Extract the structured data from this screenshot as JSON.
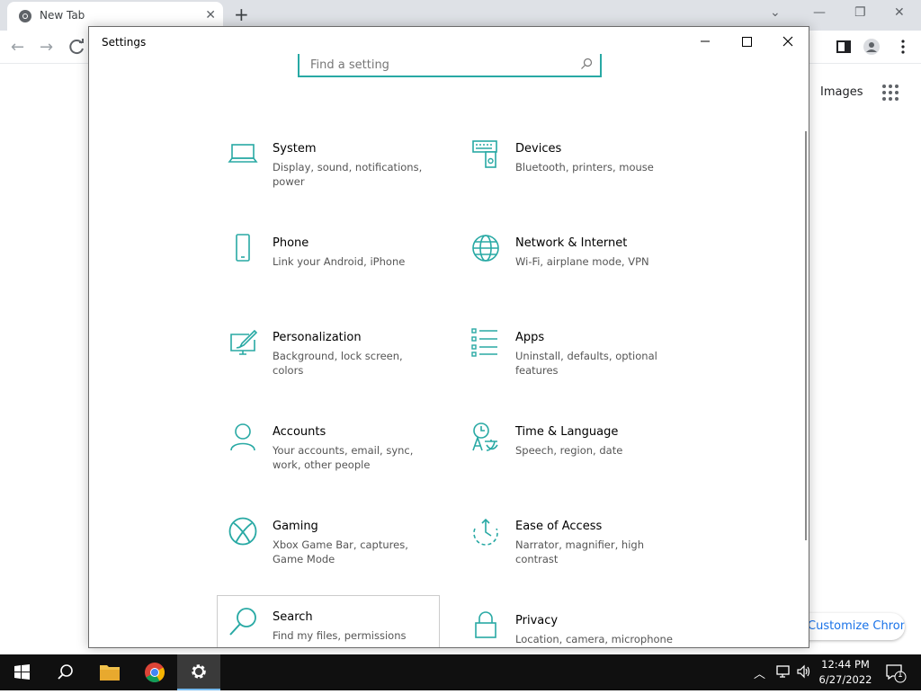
{
  "browser": {
    "tab_title": "New Tab",
    "images_link": "Images",
    "customize_label": "Customize Chrome"
  },
  "settings": {
    "title": "Settings",
    "search_placeholder": "Find a setting",
    "accent_color": "#28a9a4",
    "tiles": [
      {
        "name": "System",
        "desc": "Display, sound, notifications, power",
        "icon": "laptop-icon"
      },
      {
        "name": "Devices",
        "desc": "Bluetooth, printers, mouse",
        "icon": "devices-icon"
      },
      {
        "name": "Phone",
        "desc": "Link your Android, iPhone",
        "icon": "phone-icon"
      },
      {
        "name": "Network & Internet",
        "desc": "Wi-Fi, airplane mode, VPN",
        "icon": "globe-icon"
      },
      {
        "name": "Personalization",
        "desc": "Background, lock screen, colors",
        "icon": "paintbrush-icon"
      },
      {
        "name": "Apps",
        "desc": "Uninstall, defaults, optional features",
        "icon": "apps-list-icon"
      },
      {
        "name": "Accounts",
        "desc": "Your accounts, email, sync, work, other people",
        "icon": "person-icon"
      },
      {
        "name": "Time & Language",
        "desc": "Speech, region, date",
        "icon": "time-language-icon"
      },
      {
        "name": "Gaming",
        "desc": "Xbox Game Bar, captures, Game Mode",
        "icon": "xbox-icon"
      },
      {
        "name": "Ease of Access",
        "desc": "Narrator, magnifier, high contrast",
        "icon": "ease-of-access-icon"
      },
      {
        "name": "Search",
        "desc": "Find my files, permissions",
        "icon": "magnifier-icon"
      },
      {
        "name": "Privacy",
        "desc": "Location, camera, microphone",
        "icon": "lock-icon"
      }
    ]
  },
  "taskbar": {
    "time": "12:44 PM",
    "date": "6/27/2022",
    "notification_count": "1"
  }
}
